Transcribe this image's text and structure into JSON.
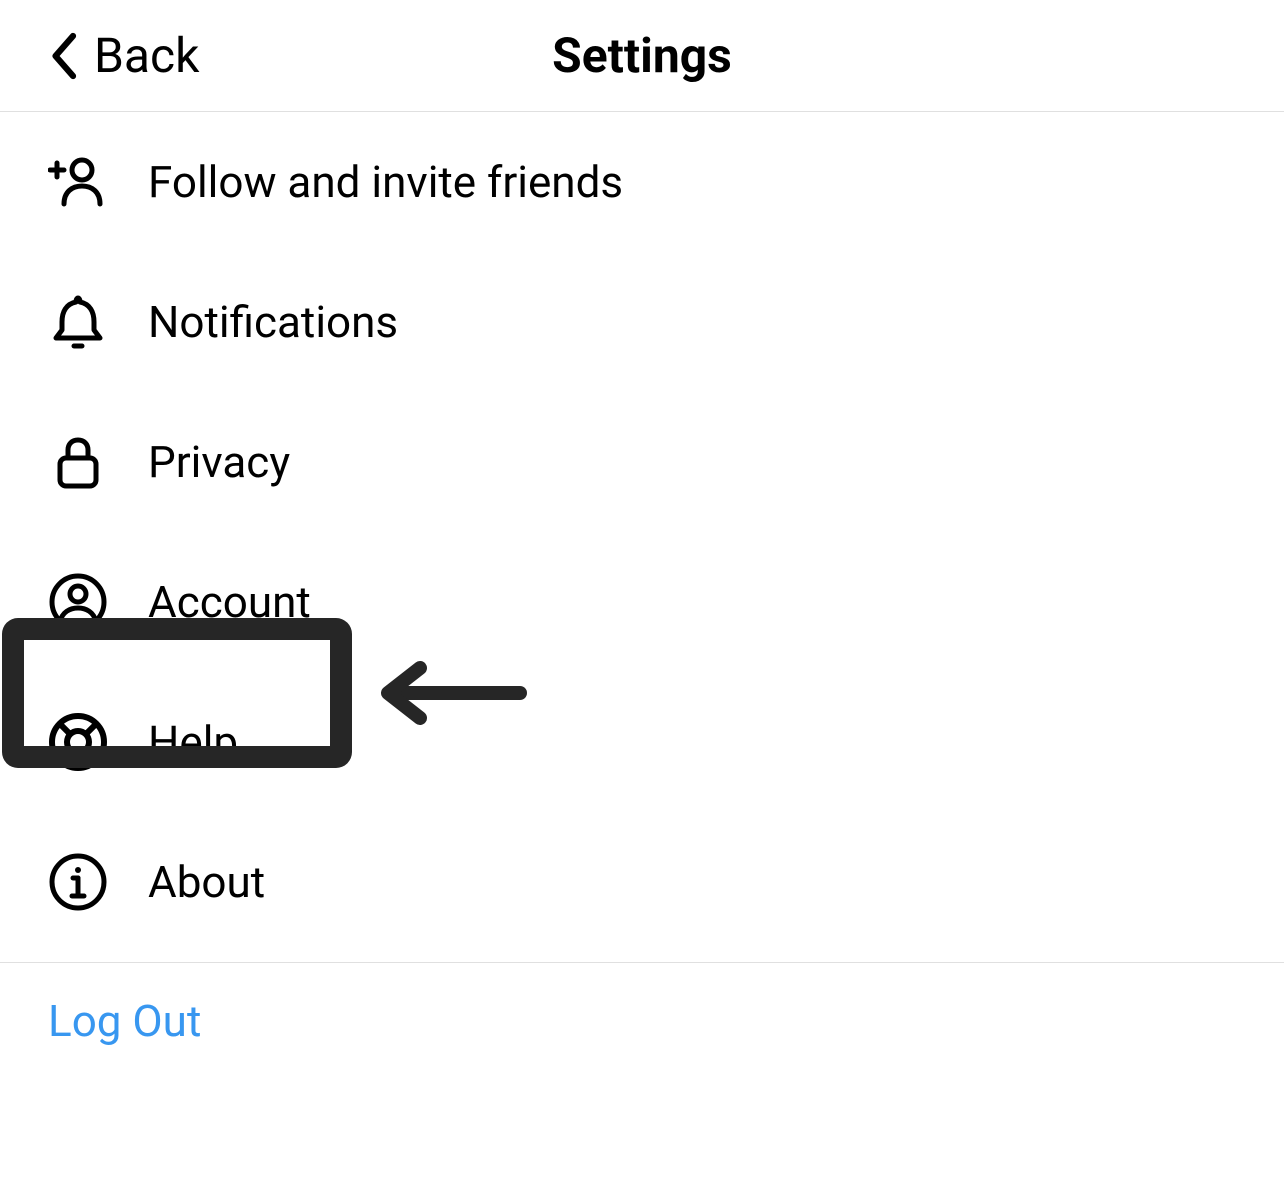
{
  "header": {
    "back_label": "Back",
    "title": "Settings"
  },
  "items": [
    {
      "icon": "add-person-icon",
      "label": "Follow and invite friends"
    },
    {
      "icon": "bell-icon",
      "label": "Notifications"
    },
    {
      "icon": "lock-icon",
      "label": "Privacy"
    },
    {
      "icon": "account-icon",
      "label": "Account"
    },
    {
      "icon": "lifebuoy-icon",
      "label": "Help"
    },
    {
      "icon": "info-icon",
      "label": "About"
    }
  ],
  "logout_label": "Log Out",
  "annotation": {
    "highlighted_item_index": 4
  }
}
